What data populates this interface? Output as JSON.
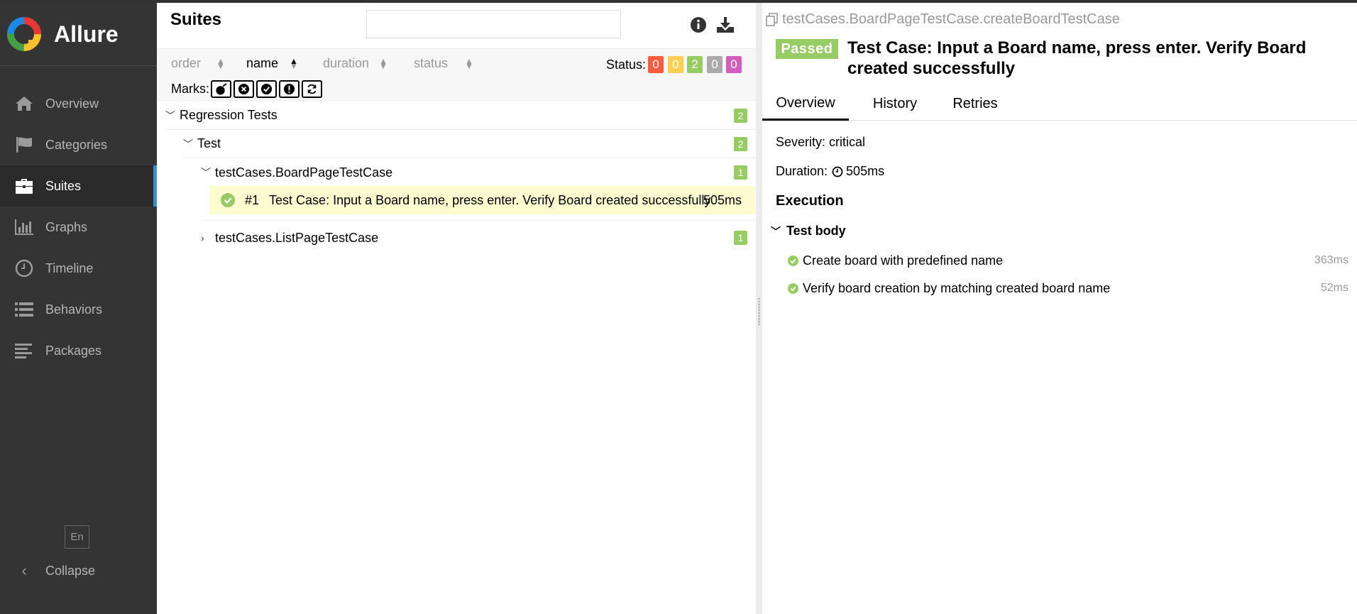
{
  "sidebar": {
    "brand": "Allure",
    "items": [
      {
        "label": "Overview",
        "icon": "home-icon",
        "active": false
      },
      {
        "label": "Categories",
        "icon": "flag-icon",
        "active": false
      },
      {
        "label": "Suites",
        "icon": "briefcase-icon",
        "active": true
      },
      {
        "label": "Graphs",
        "icon": "bar-chart-icon",
        "active": false
      },
      {
        "label": "Timeline",
        "icon": "clock-icon",
        "active": false
      },
      {
        "label": "Behaviors",
        "icon": "list-icon",
        "active": false
      },
      {
        "label": "Packages",
        "icon": "align-left-icon",
        "active": false
      }
    ],
    "language": "En",
    "collapse": "Collapse"
  },
  "suites": {
    "title": "Suites",
    "search": {
      "value": "",
      "placeholder": ""
    },
    "sort": {
      "order": "order",
      "name": "name",
      "duration": "duration",
      "status": "status"
    },
    "status_label": "Status:",
    "status_counts": [
      {
        "value": "0",
        "color": "#fd5a3e"
      },
      {
        "value": "0",
        "color": "#ffd050"
      },
      {
        "value": "2",
        "color": "#97cc64"
      },
      {
        "value": "0",
        "color": "#aaaaaa"
      },
      {
        "value": "0",
        "color": "#d35ebe"
      }
    ],
    "marks_label": "Marks:",
    "tree": {
      "regression": {
        "label": "Regression Tests",
        "count": "2"
      },
      "test": {
        "label": "Test",
        "count": "2"
      },
      "board_suite": {
        "label": "testCases.BoardPageTestCase",
        "count": "1"
      },
      "case": {
        "order": "#1",
        "label": "Test Case: Input a Board name, press enter. Verify Board created successfully",
        "duration": "505ms"
      },
      "list_suite": {
        "label": "testCases.ListPageTestCase",
        "count": "1"
      }
    }
  },
  "detail": {
    "full_name": "testCases.BoardPageTestCase.createBoardTestCase",
    "status": "Passed",
    "title": "Test Case: Input a Board name, press enter. Verify Board created successfully",
    "tabs": [
      "Overview",
      "History",
      "Retries"
    ],
    "severity": "Severity: critical",
    "duration_label": "Duration:",
    "duration_value": "505ms",
    "execution_title": "Execution",
    "test_body": "Test body",
    "steps": [
      {
        "label": "Create board with predefined name",
        "duration": "363ms"
      },
      {
        "label": "Verify board creation by matching created board name",
        "duration": "52ms"
      }
    ]
  }
}
